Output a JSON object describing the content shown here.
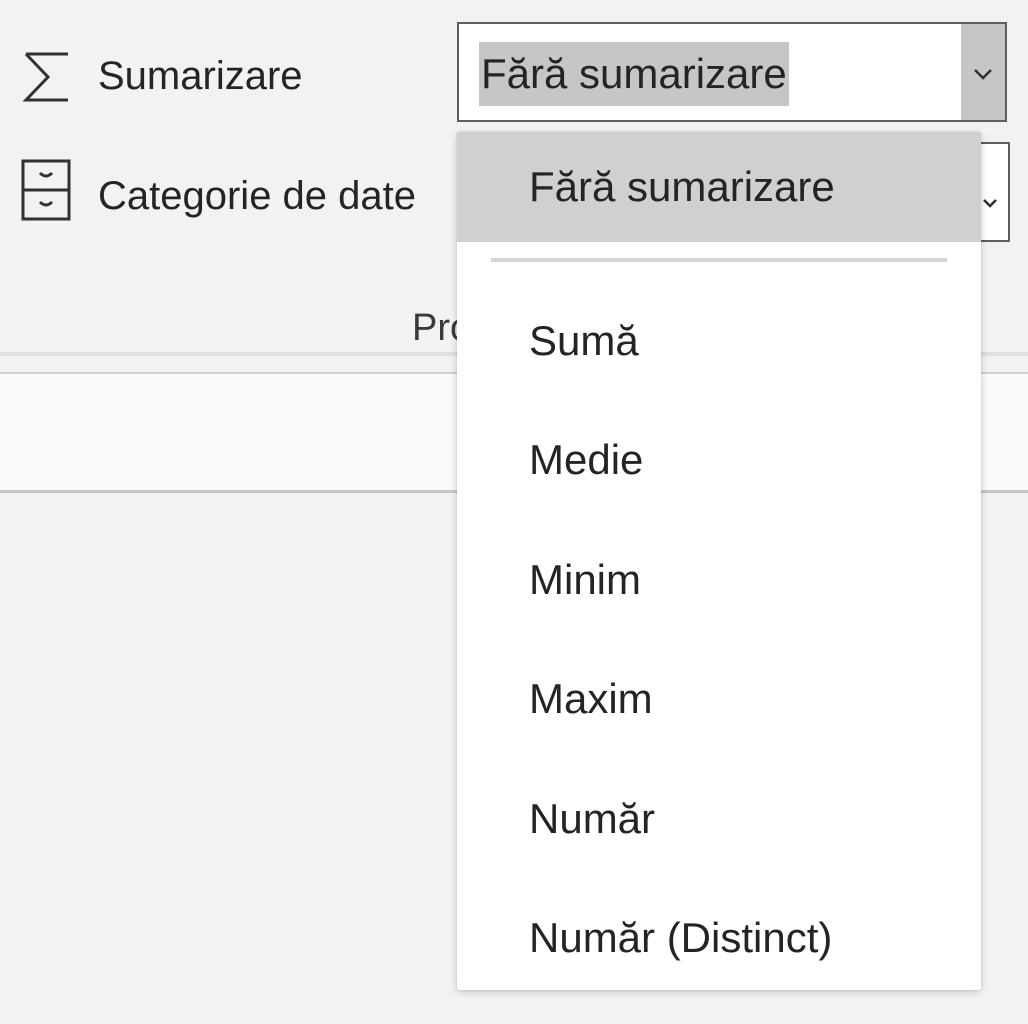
{
  "properties": {
    "summarization": {
      "label": "Sumarizare",
      "selected_value": "Fără sumarizare",
      "icon": "sigma-icon"
    },
    "data_category": {
      "label": "Categorie de date",
      "icon": "cabinet-icon"
    },
    "section_label": "Proprietăți"
  },
  "dropdown": {
    "options": [
      "Fără sumarizare",
      "Sumă",
      "Medie",
      "Minim",
      "Maxim",
      "Număr",
      "Număr (Distinct)"
    ],
    "selected_index": 0
  },
  "colors": {
    "background": "#f3f2f1",
    "selection_highlight": "#c8c6c4",
    "menu_background": "#ffffff",
    "text": "#252423"
  }
}
